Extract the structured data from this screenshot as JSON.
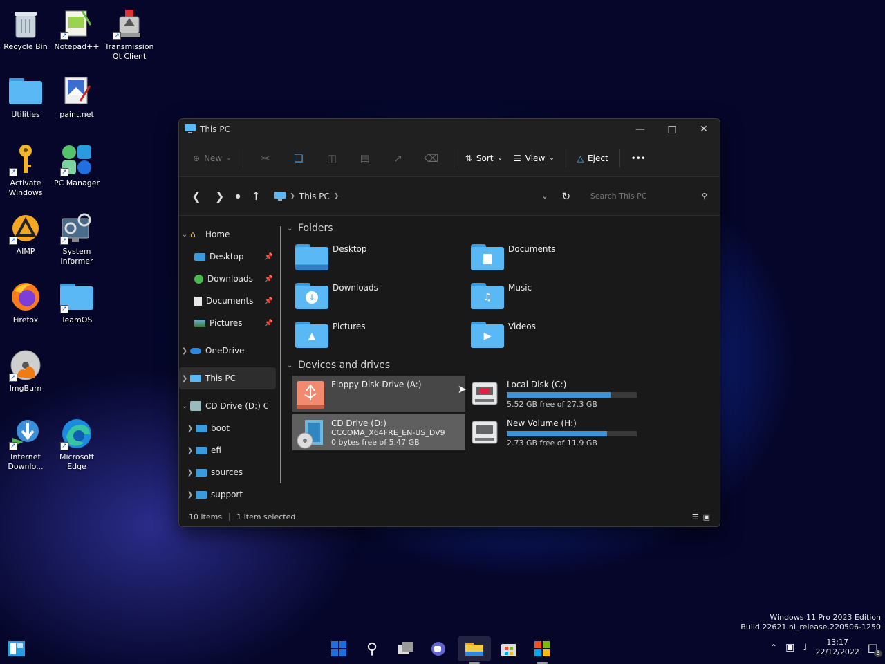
{
  "desktop": {
    "icons": [
      {
        "label": "Recycle Bin"
      },
      {
        "label": "Notepad++"
      },
      {
        "label": "Transmission\nQt Client"
      },
      {
        "label": "Utilities"
      },
      {
        "label": "paint.net"
      },
      {
        "label": "Activate\nWindows"
      },
      {
        "label": "PC Manager"
      },
      {
        "label": "AIMP"
      },
      {
        "label": "System\nInformer"
      },
      {
        "label": "Firefox"
      },
      {
        "label": "TeamOS"
      },
      {
        "label": "ImgBurn"
      },
      {
        "label": "Internet\nDownlo..."
      },
      {
        "label": "Microsoft\nEdge"
      }
    ]
  },
  "explorer": {
    "title": "This PC",
    "toolbar": {
      "new_label": "New",
      "sort_label": "Sort",
      "view_label": "View",
      "eject_label": "Eject",
      "more_label": "•••"
    },
    "address": {
      "crumb": "This PC",
      "search_placeholder": "Search This PC"
    },
    "nav": {
      "items": [
        {
          "label": "Home"
        },
        {
          "label": "Desktop"
        },
        {
          "label": "Downloads"
        },
        {
          "label": "Documents"
        },
        {
          "label": "Pictures"
        },
        {
          "label": "OneDrive"
        },
        {
          "label": "This PC"
        },
        {
          "label": "CD Drive (D:) CCC"
        },
        {
          "label": "boot"
        },
        {
          "label": "efi"
        },
        {
          "label": "sources"
        },
        {
          "label": "support"
        }
      ]
    },
    "folders_header": "Folders",
    "folders": [
      {
        "label": "Desktop"
      },
      {
        "label": "Documents"
      },
      {
        "label": "Downloads"
      },
      {
        "label": "Music"
      },
      {
        "label": "Pictures"
      },
      {
        "label": "Videos"
      }
    ],
    "drives_header": "Devices and drives",
    "drives": [
      {
        "name": "Floppy Disk Drive (A:)"
      },
      {
        "name": "Local Disk (C:)",
        "free": "5.52 GB free of 27.3 GB",
        "used_fraction": 0.8
      },
      {
        "name": "CD Drive (D:)",
        "line2": "CCCOMA_X64FRE_EN-US_DV9",
        "free": "0 bytes free of 5.47 GB"
      },
      {
        "name": "New Volume (H:)",
        "free": "2.73 GB free of 11.9 GB",
        "used_fraction": 0.77
      }
    ],
    "status": {
      "items": "10 items",
      "selected": "1 item selected"
    }
  },
  "watermark": {
    "line1": "Windows 11 Pro 2023 Edition",
    "line2": "Build 22621.ni_release.220506-1250"
  },
  "tray": {
    "time": "13:17",
    "date": "22/12/2022",
    "notif_count": "3"
  },
  "colors": {
    "accent": "#3b94d9",
    "folder": "#5ab8f5"
  }
}
